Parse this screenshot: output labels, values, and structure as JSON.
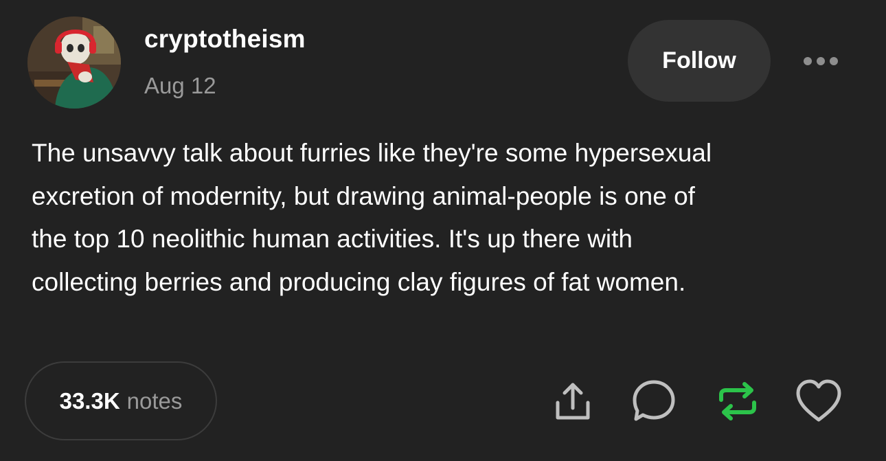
{
  "post": {
    "author": {
      "username": "cryptotheism",
      "avatar_icon": "skeleton-with-headphones-avatar"
    },
    "date": "Aug 12",
    "follow_label": "Follow",
    "more_icon": "more-options-icon",
    "body_lines": [
      "The unsavvy talk about furries like they're some hypersexual",
      "excretion of modernity, but drawing animal-people is one of",
      "the top 10 neolithic human activities. It's up there with",
      "collecting berries and producing clay figures of fat women."
    ],
    "notes": {
      "count": "33.3K",
      "label": "notes"
    },
    "actions": {
      "share_icon": "share-icon",
      "reply_icon": "comment-bubble-icon",
      "reblog_icon": "reblog-icon",
      "like_icon": "heart-icon",
      "reblog_active": true
    }
  },
  "colors": {
    "background": "#222222",
    "text_primary": "#ffffff",
    "text_secondary": "#9a9a9a",
    "button_bg": "#333333",
    "reblog_active": "#2cc34a",
    "icon": "#bfbfbf"
  }
}
